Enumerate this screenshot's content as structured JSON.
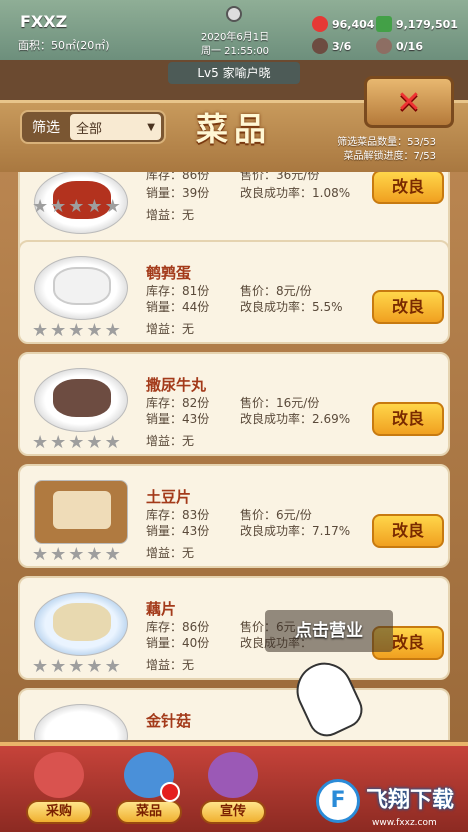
{
  "header": {
    "shop_name": "FXXZ",
    "area": "面积：50㎡(20㎡)",
    "date": "2020年6月1日",
    "time": "周一 21:55:00",
    "resources": [
      {
        "icon": "tomato-icon",
        "value": "96,404",
        "color": "#e53935"
      },
      {
        "icon": "money-icon",
        "value": "9,179,501",
        "color": "#43a047"
      },
      {
        "icon": "chef-icon",
        "value": "3/6",
        "color": "#6d4c41"
      },
      {
        "icon": "dish-icon",
        "value": "0/16",
        "color": "#8d6e63"
      }
    ],
    "level": "Lv5 家喻户晓"
  },
  "panel": {
    "filter_label": "筛选",
    "filter_value": "全部",
    "title": "菜品",
    "stats_count": "筛选菜品数量：53/53",
    "stats_unlock": "菜品解锁进度：7/53"
  },
  "labels": {
    "stock": "库存：",
    "sold": "销量：",
    "price": "售价：",
    "rate": "改良成功率：",
    "buff": "增益："
  },
  "dishes": [
    {
      "name": "",
      "stock": "86份",
      "sold": "39份",
      "price": "36元/份",
      "rate": "1.08%",
      "buff": "无",
      "button": "改良",
      "color": "#b3321e"
    },
    {
      "name": "鹌鹑蛋",
      "stock": "81份",
      "sold": "44份",
      "price": "8元/份",
      "rate": "5.5%",
      "buff": "无",
      "button": "改良",
      "color": "#f2f2f2"
    },
    {
      "name": "撒尿牛丸",
      "stock": "82份",
      "sold": "43份",
      "price": "16元/份",
      "rate": "2.69%",
      "buff": "无",
      "button": "改良",
      "color": "#6d4c41"
    },
    {
      "name": "土豆片",
      "stock": "83份",
      "sold": "43份",
      "price": "6元/份",
      "rate": "7.17%",
      "buff": "无",
      "button": "改良",
      "color": "#efdcb8"
    },
    {
      "name": "藕片",
      "stock": "86份",
      "sold": "40份",
      "price": "6元",
      "rate": "",
      "buff": "无",
      "button": "改良",
      "color": "#e8d9b0"
    },
    {
      "name": "金针菇"
    }
  ],
  "rating": {
    "filled": 0,
    "max": 5
  },
  "hint": "点击营业",
  "tabs": [
    {
      "label": "采购",
      "icon": "shop-icon",
      "color": "#d9534f"
    },
    {
      "label": "菜品",
      "icon": "dishes-icon",
      "color": "#4a90d9"
    },
    {
      "label": "宣传",
      "icon": "film-icon",
      "color": "#9b59b6"
    }
  ],
  "watermark": {
    "logo": "F",
    "text": "飞翔下载",
    "url": "www.fxxz.com"
  }
}
